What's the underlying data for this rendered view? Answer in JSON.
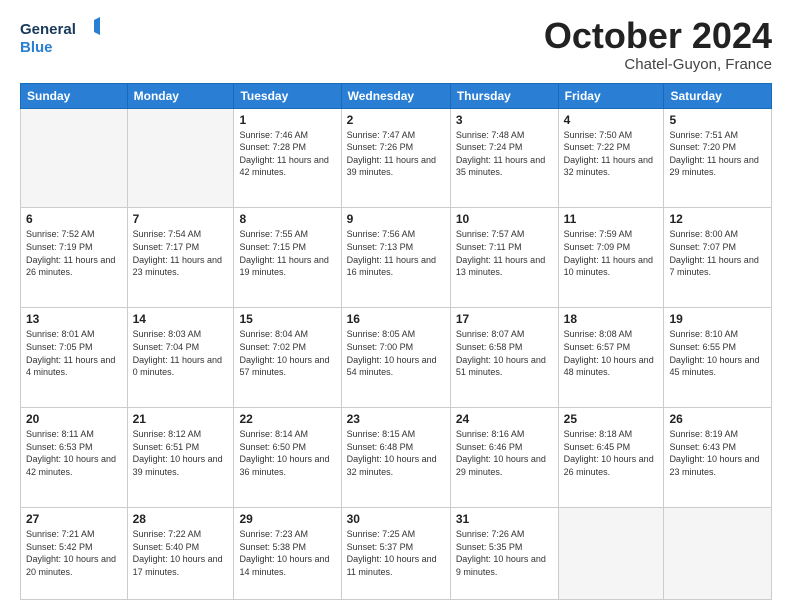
{
  "header": {
    "logo_line1": "General",
    "logo_line2": "Blue",
    "month": "October 2024",
    "location": "Chatel-Guyon, France"
  },
  "weekdays": [
    "Sunday",
    "Monday",
    "Tuesday",
    "Wednesday",
    "Thursday",
    "Friday",
    "Saturday"
  ],
  "days": [
    {
      "num": "",
      "sunrise": "",
      "sunset": "",
      "daylight": "",
      "empty": true
    },
    {
      "num": "",
      "sunrise": "",
      "sunset": "",
      "daylight": "",
      "empty": true
    },
    {
      "num": "1",
      "sunrise": "Sunrise: 7:46 AM",
      "sunset": "Sunset: 7:28 PM",
      "daylight": "Daylight: 11 hours and 42 minutes."
    },
    {
      "num": "2",
      "sunrise": "Sunrise: 7:47 AM",
      "sunset": "Sunset: 7:26 PM",
      "daylight": "Daylight: 11 hours and 39 minutes."
    },
    {
      "num": "3",
      "sunrise": "Sunrise: 7:48 AM",
      "sunset": "Sunset: 7:24 PM",
      "daylight": "Daylight: 11 hours and 35 minutes."
    },
    {
      "num": "4",
      "sunrise": "Sunrise: 7:50 AM",
      "sunset": "Sunset: 7:22 PM",
      "daylight": "Daylight: 11 hours and 32 minutes."
    },
    {
      "num": "5",
      "sunrise": "Sunrise: 7:51 AM",
      "sunset": "Sunset: 7:20 PM",
      "daylight": "Daylight: 11 hours and 29 minutes."
    },
    {
      "num": "6",
      "sunrise": "Sunrise: 7:52 AM",
      "sunset": "Sunset: 7:19 PM",
      "daylight": "Daylight: 11 hours and 26 minutes."
    },
    {
      "num": "7",
      "sunrise": "Sunrise: 7:54 AM",
      "sunset": "Sunset: 7:17 PM",
      "daylight": "Daylight: 11 hours and 23 minutes."
    },
    {
      "num": "8",
      "sunrise": "Sunrise: 7:55 AM",
      "sunset": "Sunset: 7:15 PM",
      "daylight": "Daylight: 11 hours and 19 minutes."
    },
    {
      "num": "9",
      "sunrise": "Sunrise: 7:56 AM",
      "sunset": "Sunset: 7:13 PM",
      "daylight": "Daylight: 11 hours and 16 minutes."
    },
    {
      "num": "10",
      "sunrise": "Sunrise: 7:57 AM",
      "sunset": "Sunset: 7:11 PM",
      "daylight": "Daylight: 11 hours and 13 minutes."
    },
    {
      "num": "11",
      "sunrise": "Sunrise: 7:59 AM",
      "sunset": "Sunset: 7:09 PM",
      "daylight": "Daylight: 11 hours and 10 minutes."
    },
    {
      "num": "12",
      "sunrise": "Sunrise: 8:00 AM",
      "sunset": "Sunset: 7:07 PM",
      "daylight": "Daylight: 11 hours and 7 minutes."
    },
    {
      "num": "13",
      "sunrise": "Sunrise: 8:01 AM",
      "sunset": "Sunset: 7:05 PM",
      "daylight": "Daylight: 11 hours and 4 minutes."
    },
    {
      "num": "14",
      "sunrise": "Sunrise: 8:03 AM",
      "sunset": "Sunset: 7:04 PM",
      "daylight": "Daylight: 11 hours and 0 minutes."
    },
    {
      "num": "15",
      "sunrise": "Sunrise: 8:04 AM",
      "sunset": "Sunset: 7:02 PM",
      "daylight": "Daylight: 10 hours and 57 minutes."
    },
    {
      "num": "16",
      "sunrise": "Sunrise: 8:05 AM",
      "sunset": "Sunset: 7:00 PM",
      "daylight": "Daylight: 10 hours and 54 minutes."
    },
    {
      "num": "17",
      "sunrise": "Sunrise: 8:07 AM",
      "sunset": "Sunset: 6:58 PM",
      "daylight": "Daylight: 10 hours and 51 minutes."
    },
    {
      "num": "18",
      "sunrise": "Sunrise: 8:08 AM",
      "sunset": "Sunset: 6:57 PM",
      "daylight": "Daylight: 10 hours and 48 minutes."
    },
    {
      "num": "19",
      "sunrise": "Sunrise: 8:10 AM",
      "sunset": "Sunset: 6:55 PM",
      "daylight": "Daylight: 10 hours and 45 minutes."
    },
    {
      "num": "20",
      "sunrise": "Sunrise: 8:11 AM",
      "sunset": "Sunset: 6:53 PM",
      "daylight": "Daylight: 10 hours and 42 minutes."
    },
    {
      "num": "21",
      "sunrise": "Sunrise: 8:12 AM",
      "sunset": "Sunset: 6:51 PM",
      "daylight": "Daylight: 10 hours and 39 minutes."
    },
    {
      "num": "22",
      "sunrise": "Sunrise: 8:14 AM",
      "sunset": "Sunset: 6:50 PM",
      "daylight": "Daylight: 10 hours and 36 minutes."
    },
    {
      "num": "23",
      "sunrise": "Sunrise: 8:15 AM",
      "sunset": "Sunset: 6:48 PM",
      "daylight": "Daylight: 10 hours and 32 minutes."
    },
    {
      "num": "24",
      "sunrise": "Sunrise: 8:16 AM",
      "sunset": "Sunset: 6:46 PM",
      "daylight": "Daylight: 10 hours and 29 minutes."
    },
    {
      "num": "25",
      "sunrise": "Sunrise: 8:18 AM",
      "sunset": "Sunset: 6:45 PM",
      "daylight": "Daylight: 10 hours and 26 minutes."
    },
    {
      "num": "26",
      "sunrise": "Sunrise: 8:19 AM",
      "sunset": "Sunset: 6:43 PM",
      "daylight": "Daylight: 10 hours and 23 minutes."
    },
    {
      "num": "27",
      "sunrise": "Sunrise: 7:21 AM",
      "sunset": "Sunset: 5:42 PM",
      "daylight": "Daylight: 10 hours and 20 minutes."
    },
    {
      "num": "28",
      "sunrise": "Sunrise: 7:22 AM",
      "sunset": "Sunset: 5:40 PM",
      "daylight": "Daylight: 10 hours and 17 minutes."
    },
    {
      "num": "29",
      "sunrise": "Sunrise: 7:23 AM",
      "sunset": "Sunset: 5:38 PM",
      "daylight": "Daylight: 10 hours and 14 minutes."
    },
    {
      "num": "30",
      "sunrise": "Sunrise: 7:25 AM",
      "sunset": "Sunset: 5:37 PM",
      "daylight": "Daylight: 10 hours and 11 minutes."
    },
    {
      "num": "31",
      "sunrise": "Sunrise: 7:26 AM",
      "sunset": "Sunset: 5:35 PM",
      "daylight": "Daylight: 10 hours and 9 minutes."
    },
    {
      "num": "",
      "sunrise": "",
      "sunset": "",
      "daylight": "",
      "empty": true
    },
    {
      "num": "",
      "sunrise": "",
      "sunset": "",
      "daylight": "",
      "empty": true
    }
  ]
}
